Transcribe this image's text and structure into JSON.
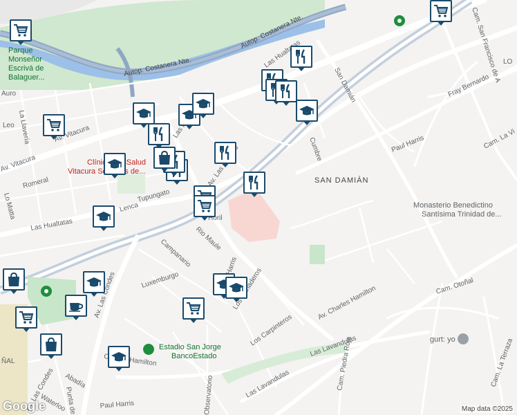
{
  "map": {
    "street_labels": [
      {
        "text": "Autop. Costanera Nte.",
        "key": "costanera1"
      },
      {
        "text": "Autop. Costanera Nte.",
        "key": "costanera2"
      },
      {
        "text": "Las Hualtatas",
        "key": "hualtatas1"
      },
      {
        "text": "Las Hualtatas",
        "key": "hualtatas2"
      },
      {
        "text": "Las Hualtatas",
        "key": "hualtatas3"
      },
      {
        "text": "Av. Vitacura",
        "key": "vitacura1"
      },
      {
        "text": "Av. Vitacura",
        "key": "vitacura2"
      },
      {
        "text": "Av. Las Condes",
        "key": "lascondes1"
      },
      {
        "text": "Av. Las Condes",
        "key": "lascondes2"
      },
      {
        "text": "Av. Las Condes",
        "key": "lascondes3"
      },
      {
        "text": "San Damián",
        "key": "sandamian"
      },
      {
        "text": "Fray Bernardo",
        "key": "fraybernardo"
      },
      {
        "text": "Paul Harris",
        "key": "paulharris1"
      },
      {
        "text": "Paul Harris",
        "key": "paulharris2"
      },
      {
        "text": "Av. Charles Hamilton",
        "key": "hamilton1"
      },
      {
        "text": "Charles Hamilton",
        "key": "hamilton2"
      },
      {
        "text": "Las Lavandulas",
        "key": "lavandulas1"
      },
      {
        "text": "Las Lavandulas",
        "key": "lavandulas2"
      },
      {
        "text": "Cam. Otoñal",
        "key": "otonal"
      },
      {
        "text": "Cam. La Vi",
        "key": "lavi"
      },
      {
        "text": "Cam. San Francisco de A",
        "key": "sanfrancisco"
      },
      {
        "text": "Los Carpinteros",
        "key": "carpinteros"
      },
      {
        "text": "Los Ganaderos",
        "key": "ganaderos"
      },
      {
        "text": "Cam. Piedra Roja",
        "key": "piedraroja"
      },
      {
        "text": "Rio Maule",
        "key": "riomaule"
      },
      {
        "text": "Campanario",
        "key": "campanario"
      },
      {
        "text": "Luxemburgo",
        "key": "luxemburgo"
      },
      {
        "text": "Tupungato",
        "key": "tupungato"
      },
      {
        "text": "Lenca",
        "key": "lenca"
      },
      {
        "text": "Romeral",
        "key": "romeral"
      },
      {
        "text": "La Llavería",
        "key": "llaveria"
      },
      {
        "text": "Leo",
        "key": "leo"
      },
      {
        "text": "Lo Matta",
        "key": "lomatta"
      },
      {
        "text": "Abadía",
        "key": "abadia"
      },
      {
        "text": "Waterloo",
        "key": "waterloo"
      },
      {
        "text": "Punta de",
        "key": "puntade"
      },
      {
        "text": "Observatorio",
        "key": "observatorio"
      },
      {
        "text": "Harris",
        "key": "harris3"
      },
      {
        "text": "LO",
        "key": "lo"
      },
      {
        "text": "Cam. La Terraza",
        "key": "terraza"
      },
      {
        "text": "Cumbre",
        "key": "cumbre"
      },
      {
        "text": "Horil",
        "key": "horil"
      },
      {
        "text": "ÑAL",
        "key": "nal"
      },
      {
        "text": "Auro",
        "key": "auro"
      }
    ],
    "area_label": "SAN DAMIÁN",
    "poi_labels": {
      "monasterio_line1": "Monasterio Benedictino",
      "monasterio_line2": "Santísima Trinidad de...",
      "parque_line1": "Parque",
      "parque_line2": "Monseñor",
      "parque_line3": "Escrivá de",
      "parque_line4": "Balaguer...",
      "redsalud_line1": "Clínica RedSalud",
      "redsalud_line2": "Vitacura Servicios de...",
      "estadio_line1": "Estadio San Jorge",
      "estadio_line2": "BancoEstado",
      "gurt": "gurt: yo"
    },
    "markers": [
      {
        "type": "cart",
        "name": "cart-icon"
      },
      {
        "type": "cart",
        "name": "cart-icon"
      },
      {
        "type": "cart",
        "name": "cart-icon"
      },
      {
        "type": "cart",
        "name": "cart-icon"
      },
      {
        "type": "cart",
        "name": "cart-icon"
      },
      {
        "type": "cart",
        "name": "cart-icon"
      },
      {
        "type": "cart",
        "name": "cart-icon"
      },
      {
        "type": "fork",
        "name": "fork-knife-icon"
      },
      {
        "type": "fork",
        "name": "fork-knife-icon"
      },
      {
        "type": "fork",
        "name": "fork-knife-icon"
      },
      {
        "type": "fork",
        "name": "fork-knife-icon"
      },
      {
        "type": "fork",
        "name": "fork-knife-icon"
      },
      {
        "type": "fork",
        "name": "fork-knife-icon"
      },
      {
        "type": "fork",
        "name": "fork-knife-icon"
      },
      {
        "type": "fork",
        "name": "fork-knife-icon"
      },
      {
        "type": "fork",
        "name": "fork-knife-icon"
      },
      {
        "type": "grad",
        "name": "graduation-cap-icon"
      },
      {
        "type": "grad",
        "name": "graduation-cap-icon"
      },
      {
        "type": "grad",
        "name": "graduation-cap-icon"
      },
      {
        "type": "grad",
        "name": "graduation-cap-icon"
      },
      {
        "type": "grad",
        "name": "graduation-cap-icon"
      },
      {
        "type": "grad",
        "name": "graduation-cap-icon"
      },
      {
        "type": "grad",
        "name": "graduation-cap-icon"
      },
      {
        "type": "grad",
        "name": "graduation-cap-icon"
      },
      {
        "type": "grad",
        "name": "graduation-cap-icon"
      },
      {
        "type": "grad",
        "name": "graduation-cap-icon"
      },
      {
        "type": "bag",
        "name": "shopping-bag-icon"
      },
      {
        "type": "bag",
        "name": "shopping-bag-icon"
      },
      {
        "type": "bag",
        "name": "shopping-bag-icon"
      },
      {
        "type": "cup",
        "name": "coffee-cup-icon"
      }
    ],
    "logo": "Google",
    "attribution": "Map data ©2025",
    "colors": {
      "marker_border": "#1a4a6b",
      "park": "#c8e6c9",
      "highway": "#8fa7c4",
      "water": "#9cc0e7",
      "hospital": "#f8d7d3"
    }
  }
}
